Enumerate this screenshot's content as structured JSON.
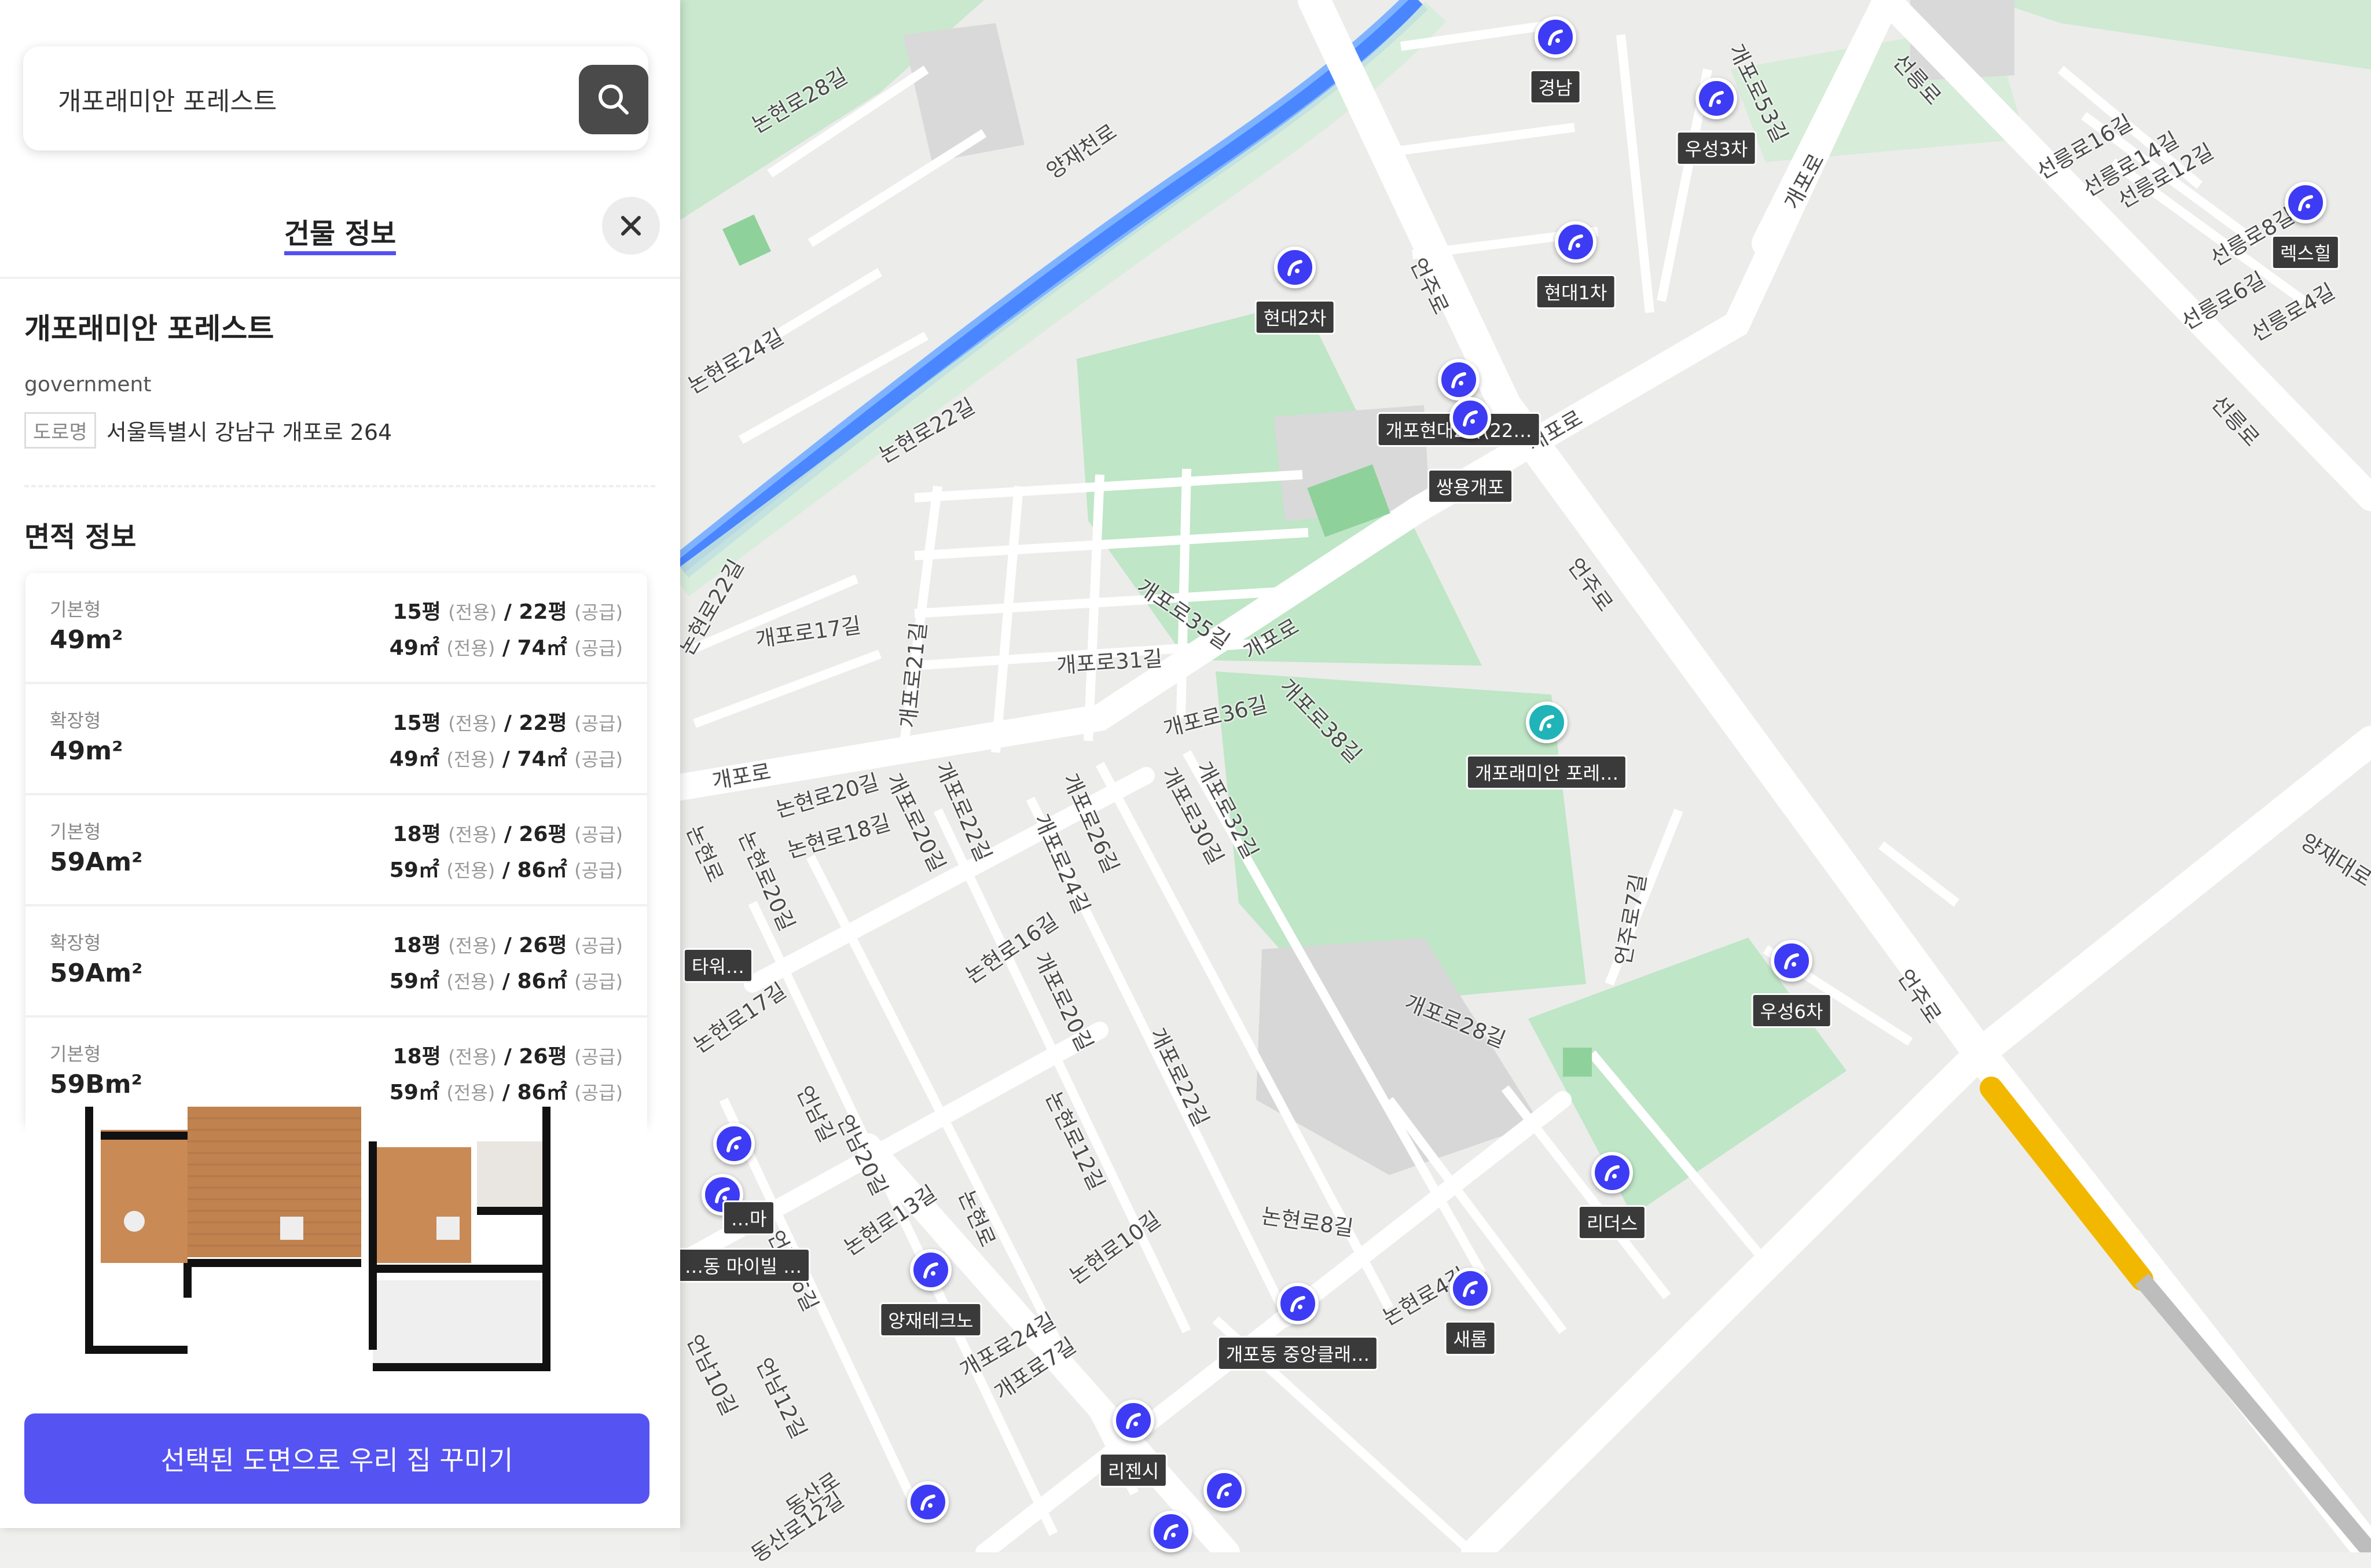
{
  "search": {
    "value": "개포래미안 포레스트"
  },
  "panel": {
    "header_title": "건물 정보",
    "building_name": "개포래미안 포레스트",
    "source": "government",
    "address_tag": "도로명",
    "address": "서울특별시 강남구 개포로 264",
    "area_section_title": "면적 정보",
    "cta_label": "선택된 도면으로 우리 집 꾸미기",
    "area_rows": [
      {
        "type": "기본형",
        "name": "49m²",
        "py_exclusive": "15평",
        "py_supply": "22평",
        "m2_exclusive": "49㎡",
        "m2_supply": "74㎡"
      },
      {
        "type": "확장형",
        "name": "49m²",
        "py_exclusive": "15평",
        "py_supply": "22평",
        "m2_exclusive": "49㎡",
        "m2_supply": "74㎡"
      },
      {
        "type": "기본형",
        "name": "59Am²",
        "py_exclusive": "18평",
        "py_supply": "26평",
        "m2_exclusive": "59㎡",
        "m2_supply": "86㎡"
      },
      {
        "type": "확장형",
        "name": "59Am²",
        "py_exclusive": "18평",
        "py_supply": "26평",
        "m2_exclusive": "59㎡",
        "m2_supply": "86㎡"
      },
      {
        "type": "기본형",
        "name": "59Bm²",
        "py_exclusive": "18평",
        "py_supply": "26평",
        "m2_exclusive": "59㎡",
        "m2_supply": "86㎡"
      }
    ],
    "exclusive_label": "(전용)",
    "supply_label": "(공급)"
  },
  "map": {
    "streets": [
      "개포로17길",
      "개포로21길",
      "개포로31길",
      "개포로35길",
      "개포로36길",
      "개포로38길",
      "개포로28길",
      "개포로26길",
      "개포로24길",
      "개포로30길",
      "개포로32길",
      "개포로22길",
      "개포로20길",
      "개포로",
      "개포로",
      "개포로",
      "개포로",
      "논현로28길",
      "논현로24길",
      "논현로22길",
      "논현로22길",
      "논현로20길",
      "논현로18길",
      "논현로16길",
      "논현로12길",
      "논현로10길",
      "논현로8길",
      "논현로4길",
      "논현로17길",
      "논현로20길",
      "논현로",
      "논현로",
      "양재천로",
      "언주로",
      "언주로",
      "언주로",
      "언주로7길",
      "선릉로",
      "선릉로",
      "선릉로16길",
      "선릉로14길",
      "선릉로12길",
      "선릉로8길",
      "선릉로6길",
      "선릉로4길",
      "개포로53길",
      "언남길",
      "언남16길",
      "언남12길",
      "언남10길",
      "언남20길",
      "논현로13길",
      "동산로",
      "동산로12길",
      "개포로20길",
      "개포로22길",
      "개포로24길",
      "개포로7길",
      "양재대로"
    ],
    "markers": [
      {
        "label": "경남"
      },
      {
        "label": "우성3차"
      },
      {
        "label": "렉스힐"
      },
      {
        "label": "현대2차"
      },
      {
        "label": "현대1차"
      },
      {
        "label": "개포현대2차(22…"
      },
      {
        "label": "쌍용개포"
      },
      {
        "label": "개포래미안 포레…"
      },
      {
        "label": "우성6차"
      },
      {
        "label": "리더스"
      },
      {
        "label": "새롬"
      },
      {
        "label": "개포동 중앙클래…"
      },
      {
        "label": "양재테크노"
      },
      {
        "label": "리젠시"
      },
      {
        "label": "…동 마이빌 …"
      },
      {
        "label": "…마"
      },
      {
        "label": "타워…"
      },
      {
        "label": ""
      },
      {
        "label": ""
      },
      {
        "label": ""
      },
      {
        "label": ""
      },
      {
        "label": ""
      }
    ],
    "colors": {
      "water": "#4a86ff",
      "park": "#bfe6c6",
      "road": "#ffffff",
      "subway": "#f2b800"
    }
  }
}
